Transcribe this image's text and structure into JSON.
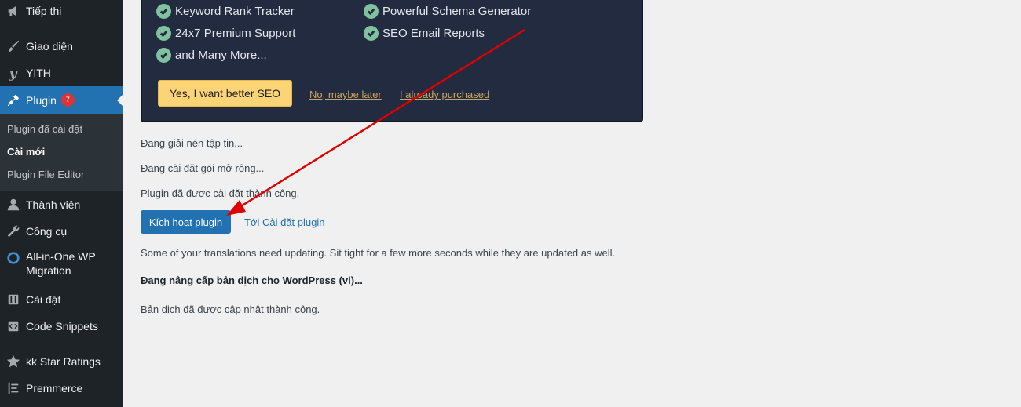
{
  "sidebar": {
    "items": [
      {
        "label": "Tiếp thị",
        "icon": "megaphone-icon"
      },
      {
        "label": "Giao diện",
        "icon": "paintbrush-icon"
      },
      {
        "label": "YITH",
        "icon": "yith-icon"
      },
      {
        "label": "Plugin",
        "icon": "plugin-icon",
        "badge": "7"
      },
      {
        "label": "Thành viên",
        "icon": "user-icon"
      },
      {
        "label": "Công cụ",
        "icon": "wrench-icon"
      },
      {
        "label": "All-in-One WP",
        "label2": "Migration",
        "icon": "migration-icon"
      },
      {
        "label": "Cài đặt",
        "icon": "settings-icon"
      },
      {
        "label": "Code Snippets",
        "icon": "code-icon"
      },
      {
        "label": "kk Star Ratings",
        "icon": "star-icon"
      },
      {
        "label": "Premmerce",
        "icon": "premmerce-icon"
      }
    ],
    "submenu": [
      "Plugin đã cài đặt",
      "Cài mới",
      "Plugin File Editor"
    ]
  },
  "promo": {
    "features": [
      "Keyword Rank Tracker",
      "Powerful Schema Generator",
      "24x7 Premium Support",
      "SEO Email Reports",
      "and Many More..."
    ],
    "yes_label": "Yes, I want better SEO",
    "maybe_label": "No, maybe later",
    "purchased_label": "I already purchased"
  },
  "log": {
    "unpacking": "Đang giải nén tập tin...",
    "installing": "Đang cài đặt gói mở rộng...",
    "installed": "Plugin đã được cài đặt thành công.",
    "activate_label": "Kích hoạt plugin",
    "settings_link": "Tới Cài đặt plugin",
    "translations_note": "Some of your translations need updating. Sit tight for a few more seconds while they are updated as well.",
    "upgrading": "Đang nâng cấp bản dịch cho WordPress (vi)...",
    "translations_done": "Bản dịch đã được cập nhật thành công."
  },
  "colors": {
    "sidebar": "#1d2327",
    "accent": "#2271b1",
    "promo_bg": "#222b3f",
    "arrow": "#e00000"
  }
}
